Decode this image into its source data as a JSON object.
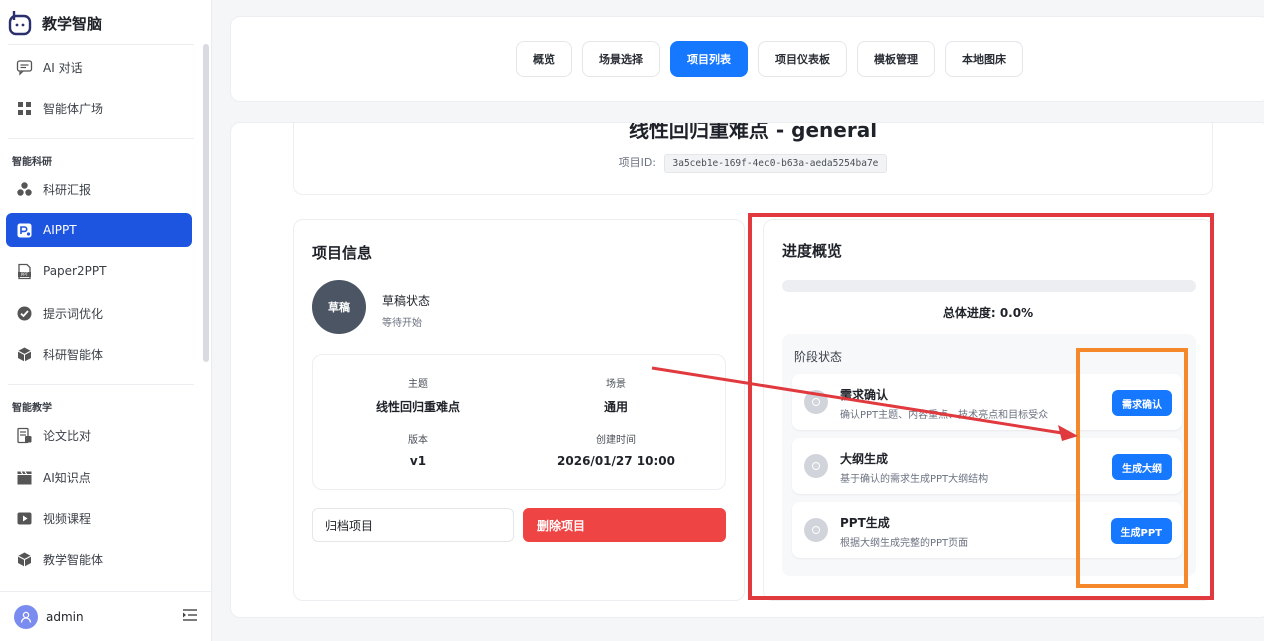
{
  "brand": {
    "title": "教学智脑"
  },
  "sidebar": {
    "top_items": [
      {
        "label": "AI 对话",
        "icon": "chat-icon"
      },
      {
        "label": "智能体广场",
        "icon": "grid-icon"
      }
    ],
    "sections": [
      {
        "title": "智能科研",
        "items": [
          {
            "label": "科研汇报",
            "icon": "cluster-icon"
          },
          {
            "label": "AIPPT",
            "icon": "ppt-icon",
            "active": true
          },
          {
            "label": "Paper2PPT",
            "icon": "paper-ppt-icon"
          },
          {
            "label": "提示词优化",
            "icon": "check-circle-icon"
          },
          {
            "label": "科研智能体",
            "icon": "cube-icon"
          }
        ]
      },
      {
        "title": "智能教学",
        "items": [
          {
            "label": "论文比对",
            "icon": "compare-icon"
          },
          {
            "label": "AI知识点",
            "icon": "clapper-icon"
          },
          {
            "label": "视频课程",
            "icon": "video-icon"
          },
          {
            "label": "教学智能体",
            "icon": "cube-icon"
          }
        ]
      }
    ],
    "user": {
      "name": "admin",
      "avatar_icon": "user-icon",
      "collapse_icon": "collapse-menu-icon"
    }
  },
  "tabs": [
    {
      "label": "概览"
    },
    {
      "label": "场景选择"
    },
    {
      "label": "项目列表",
      "active": true
    },
    {
      "label": "项目仪表板"
    },
    {
      "label": "模板管理"
    },
    {
      "label": "本地图床"
    }
  ],
  "project": {
    "title": "线性回归重难点 - general",
    "id_label": "项目ID:",
    "id": "3a5ceb1e-169f-4ec0-b63a-aeda5254ba7e"
  },
  "info": {
    "title": "项目信息",
    "status_badge": "草稿",
    "status_title": "草稿状态",
    "status_sub": "等待开始",
    "meta": {
      "topic_label": "主题",
      "topic_value": "线性回归重难点",
      "scene_label": "场景",
      "scene_value": "通用",
      "version_label": "版本",
      "version_value": "v1",
      "created_label": "创建时间",
      "created_value": "2026/01/27 10:00"
    },
    "archive_label": "归档项目",
    "delete_label": "删除项目"
  },
  "progress": {
    "title": "进度概览",
    "overall_text": "总体进度: 0.0%",
    "percent": 0,
    "stage_header": "阶段状态",
    "stages": [
      {
        "name": "需求确认",
        "desc": "确认PPT主题、内容重点、技术亮点和目标受众",
        "button": "需求确认"
      },
      {
        "name": "大纲生成",
        "desc": "基于确认的需求生成PPT大纲结构",
        "button": "生成大纲"
      },
      {
        "name": "PPT生成",
        "desc": "根据大纲生成完整的PPT页面",
        "button": "生成PPT"
      }
    ]
  },
  "colors": {
    "primary": "#1677ff",
    "sidebar_active": "#1e55e0",
    "danger": "#ef4444",
    "annotation_red": "#e0393e",
    "annotation_orange": "#f5882a"
  }
}
